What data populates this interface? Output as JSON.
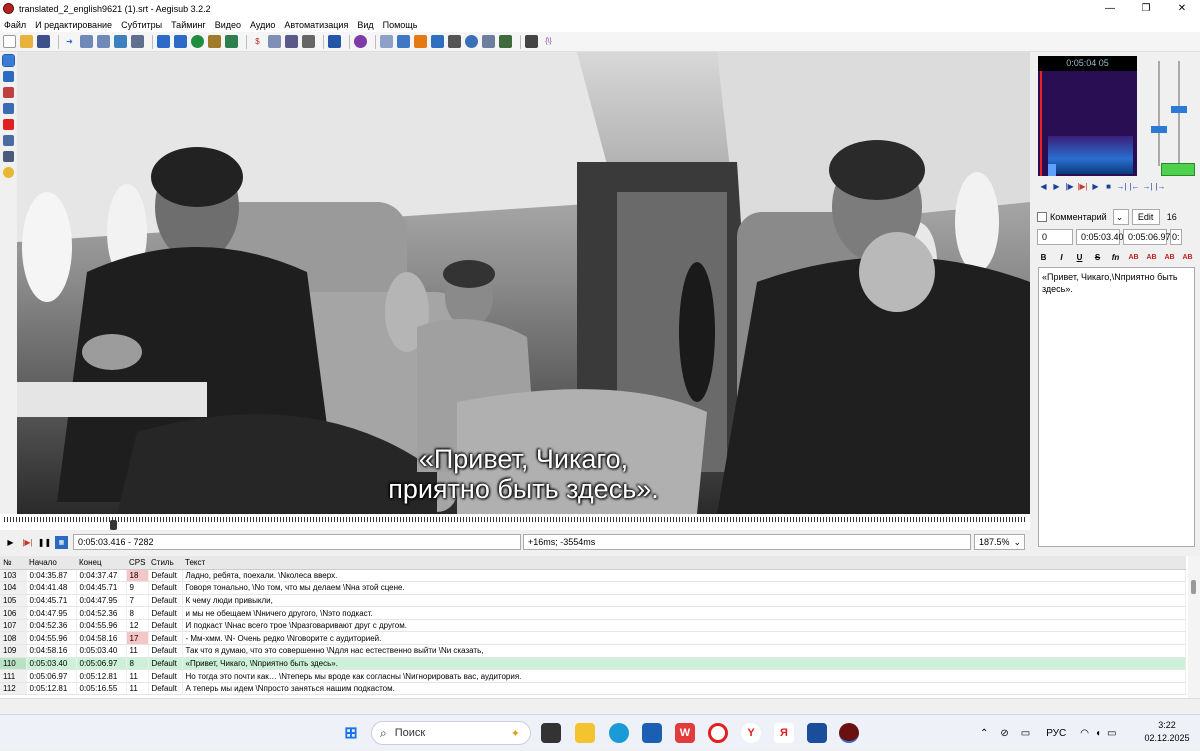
{
  "window": {
    "title": "translated_2_english9621 (1).srt - Aegisub 3.2.2",
    "minimize": "—",
    "maximize": "❐",
    "close": "✕"
  },
  "menu": [
    "Файл",
    "И редактирование",
    "Субтитры",
    "Тайминг",
    "Видео",
    "Аудио",
    "Автоматизация",
    "Вид",
    "Помощь"
  ],
  "video": {
    "subtitle_line1": "«Привет, Чикаго,",
    "subtitle_line2": "приятно быть здесь».",
    "position": "0:05:03.416 - 7282",
    "offset": "+16ms; -3554ms",
    "zoom": "187.5%"
  },
  "audio": {
    "header": "0:05:04 05"
  },
  "edit": {
    "comment_label": "Комментарий",
    "edit_button": "Edit",
    "margin": "16",
    "layer": "0",
    "start": "0:05:03.40",
    "end": "0:05:06.97",
    "duration": "0:",
    "text": "«Привет, Чикаго,\\Nприятно быть здесь».",
    "format_buttons": [
      "B",
      "I",
      "U",
      "S",
      "fn",
      "AB",
      "AB",
      "AB",
      "AB"
    ]
  },
  "grid": {
    "headers": [
      "№",
      "Начало",
      "Конец",
      "CPS",
      "Стиль",
      "Текст"
    ],
    "rows": [
      {
        "num": "103",
        "start": "0:04:35.87",
        "end": "0:04:37.47",
        "cps": "18",
        "style": "Default",
        "text": "Ладно, ребята, поехали. \\Nколеса вверх."
      },
      {
        "num": "104",
        "start": "0:04:41.48",
        "end": "0:04:45.71",
        "cps": "9",
        "style": "Default",
        "text": "Говоря тонально, \\No том, что мы делаем \\Nна этой сцене."
      },
      {
        "num": "105",
        "start": "0:04:45.71",
        "end": "0:04:47.95",
        "cps": "7",
        "style": "Default",
        "text": "К чему люди привыкли,"
      },
      {
        "num": "106",
        "start": "0:04:47.95",
        "end": "0:04:52.36",
        "cps": "8",
        "style": "Default",
        "text": "и мы не обещаем \\Nничего другого, \\Nэто подкаст."
      },
      {
        "num": "107",
        "start": "0:04:52.36",
        "end": "0:04:55.96",
        "cps": "12",
        "style": "Default",
        "text": "И подкаст \\Nнас всего трое \\Nразговаривают друг с другом."
      },
      {
        "num": "108",
        "start": "0:04:55.96",
        "end": "0:04:58.16",
        "cps": "17",
        "style": "Default",
        "text": "- Мм-хмм. \\N- Очень редко \\Nговорите с аудиторией."
      },
      {
        "num": "109",
        "start": "0:04:58.16",
        "end": "0:05:03.40",
        "cps": "11",
        "style": "Default",
        "text": "Так что я думаю, что это совершенно \\Nдля нас естественно выйти \\Nи сказать,"
      },
      {
        "num": "110",
        "start": "0:05:03.40",
        "end": "0:05:06.97",
        "cps": "8",
        "style": "Default",
        "text": "«Привет, Чикаго, \\Nприятно быть здесь»."
      },
      {
        "num": "111",
        "start": "0:05:06.97",
        "end": "0:05:12.81",
        "cps": "11",
        "style": "Default",
        "text": "Но тогда это почти как… \\Nтеперь мы вроде как согласны \\Nигнорировать вас, аудитория."
      },
      {
        "num": "112",
        "start": "0:05:12.81",
        "end": "0:05:16.55",
        "cps": "11",
        "style": "Default",
        "text": "А теперь мы идем \\Nпросто заняться нашим подкастом."
      }
    ]
  },
  "taskbar": {
    "search_placeholder": "Поиск",
    "lang": "РУС",
    "time": "3:22",
    "date": "02.12.2025"
  }
}
